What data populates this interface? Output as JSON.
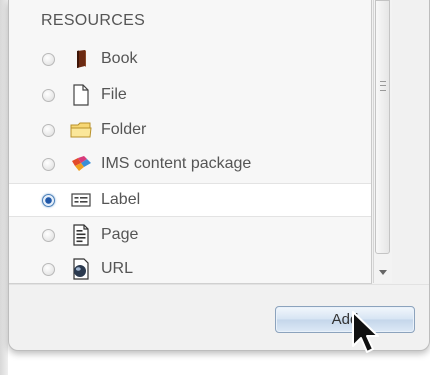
{
  "section": {
    "heading": "RESOURCES"
  },
  "items": [
    {
      "label": "Book",
      "icon": "book-icon",
      "selected": false
    },
    {
      "label": "File",
      "icon": "file-icon",
      "selected": false
    },
    {
      "label": "Folder",
      "icon": "folder-icon",
      "selected": false
    },
    {
      "label": "IMS content package",
      "icon": "ims-package-icon",
      "selected": false
    },
    {
      "label": "Label",
      "icon": "label-icon",
      "selected": true
    },
    {
      "label": "Page",
      "icon": "page-icon",
      "selected": false
    },
    {
      "label": "URL",
      "icon": "url-globe-icon",
      "selected": false
    }
  ],
  "footer": {
    "add_label": "Add"
  },
  "colors": {
    "accent": "#1f57a8",
    "selected_row": "#ffffff",
    "button_border": "#8ca3bd"
  }
}
